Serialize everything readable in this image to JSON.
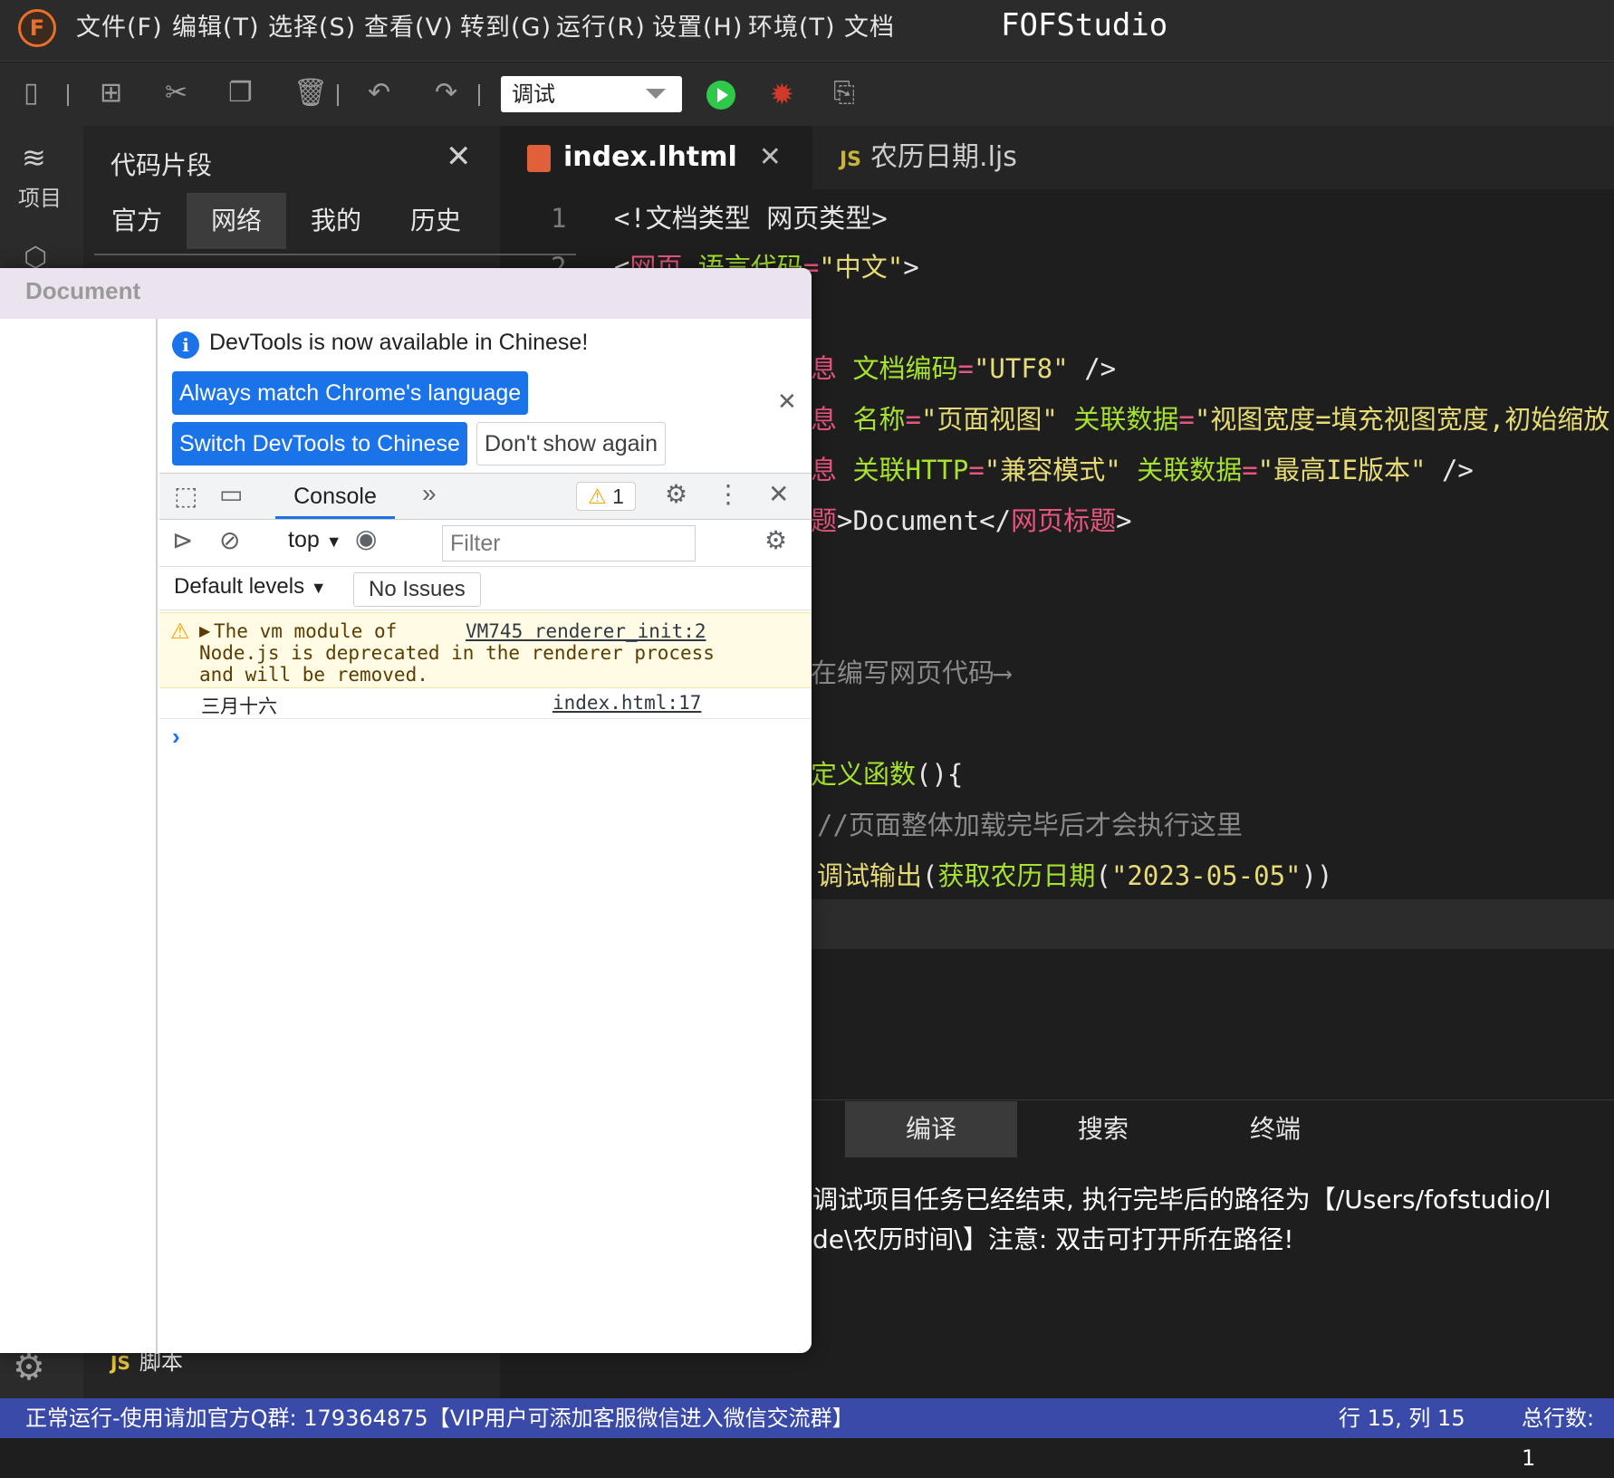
{
  "app": {
    "name": "FOFStudio",
    "logo_letter": "F",
    "menu": [
      "文件(F)",
      "编辑(T)",
      "选择(S)",
      "查看(V)",
      "转到(G)",
      "运行(R)",
      "设置(H)",
      "环境(T)",
      "文档"
    ]
  },
  "toolbar": {
    "mode_value": "调试",
    "icons": [
      "save-icon",
      "new-file-icon",
      "cut-icon",
      "copy-icon",
      "delete-icon",
      "undo-icon",
      "redo-icon",
      "run-icon",
      "debug-icon",
      "find-in-files-icon"
    ]
  },
  "activity": {
    "project_label": "项目"
  },
  "snippets": {
    "title": "代码片段",
    "tabs": [
      "官方",
      "网络",
      "我的",
      "历史"
    ],
    "active_tab": "网络",
    "tree_item_badge": "JS",
    "tree_item": "脚本"
  },
  "editor": {
    "tabs": [
      {
        "label": "index.lhtml",
        "active": true
      },
      {
        "badge": "JS",
        "label": "农历日期.ljs",
        "active": false
      }
    ],
    "line1_number": "1",
    "line1": "<!文档类型 网页类型>",
    "line2_number": "2",
    "line2_tag": "网页",
    "line2_attr": "语言代码",
    "line2_value": "\"中文\"",
    "line5_kw": "息",
    "line5_attr": "文档编码",
    "line5_value": "\"UTF8\"",
    "line6_kw": "息",
    "line6_attr1": "名称",
    "line6_value1": "\"页面视图\"",
    "line6_attr2": "关联数据",
    "line6_value2": "\"视图宽度=填充视图宽度,初始缩放",
    "line7_kw": "息",
    "line7_attr1": "关联HTTP",
    "line7_value1": "\"兼容模式\"",
    "line7_attr2": "关联数据",
    "line7_value2": "\"最高IE版本\"",
    "line8_kw1": "题",
    "line8_text": "Document",
    "line8_kw2": "网页标题",
    "line11_comment": "在编写网页代码⟶",
    "line13_fn": "定义函数",
    "line14_comment": "//页面整体加载完毕后才会执行这里",
    "line15_fn": "调试输出",
    "line15_call": "获取农历日期",
    "line15_arg": "\"2023-05-05\""
  },
  "bottom_panel": {
    "tabs": [
      "编译",
      "搜索",
      "终端"
    ],
    "active_tab": "编译",
    "output_line1": "调试项目任务已经结束, 执行完毕后的路径为【/Users/fofstudio/I",
    "output_line2": "de\\农历时间\\】注意: 双击可打开所在路径!"
  },
  "status": {
    "message": "正常运行-使用请加官方Q群: 179364875【VIP用户可添加客服微信进入微信交流群】",
    "position": "行 15, 列 15",
    "total_lines": "总行数: 1"
  },
  "devtools": {
    "window_title": "Document",
    "info_text": "DevTools is now available in Chinese!",
    "btn_match_language": "Always match Chrome's language",
    "btn_switch_chinese": "Switch DevTools to Chinese",
    "btn_dont_show": "Don't show again",
    "console_tab": "Console",
    "more_tabs": "»",
    "warning_count": "1",
    "context_select": "top",
    "filter_placeholder": "Filter",
    "levels_select": "Default levels",
    "issues_button": "No Issues",
    "warning": {
      "line1": "The vm module of",
      "line2": "Node.js is deprecated in the renderer process",
      "line3": "and will be removed.",
      "source": "VM745 renderer_init:2"
    },
    "log": {
      "text": "三月十六",
      "source": "index.html:17"
    },
    "prompt": "›"
  }
}
